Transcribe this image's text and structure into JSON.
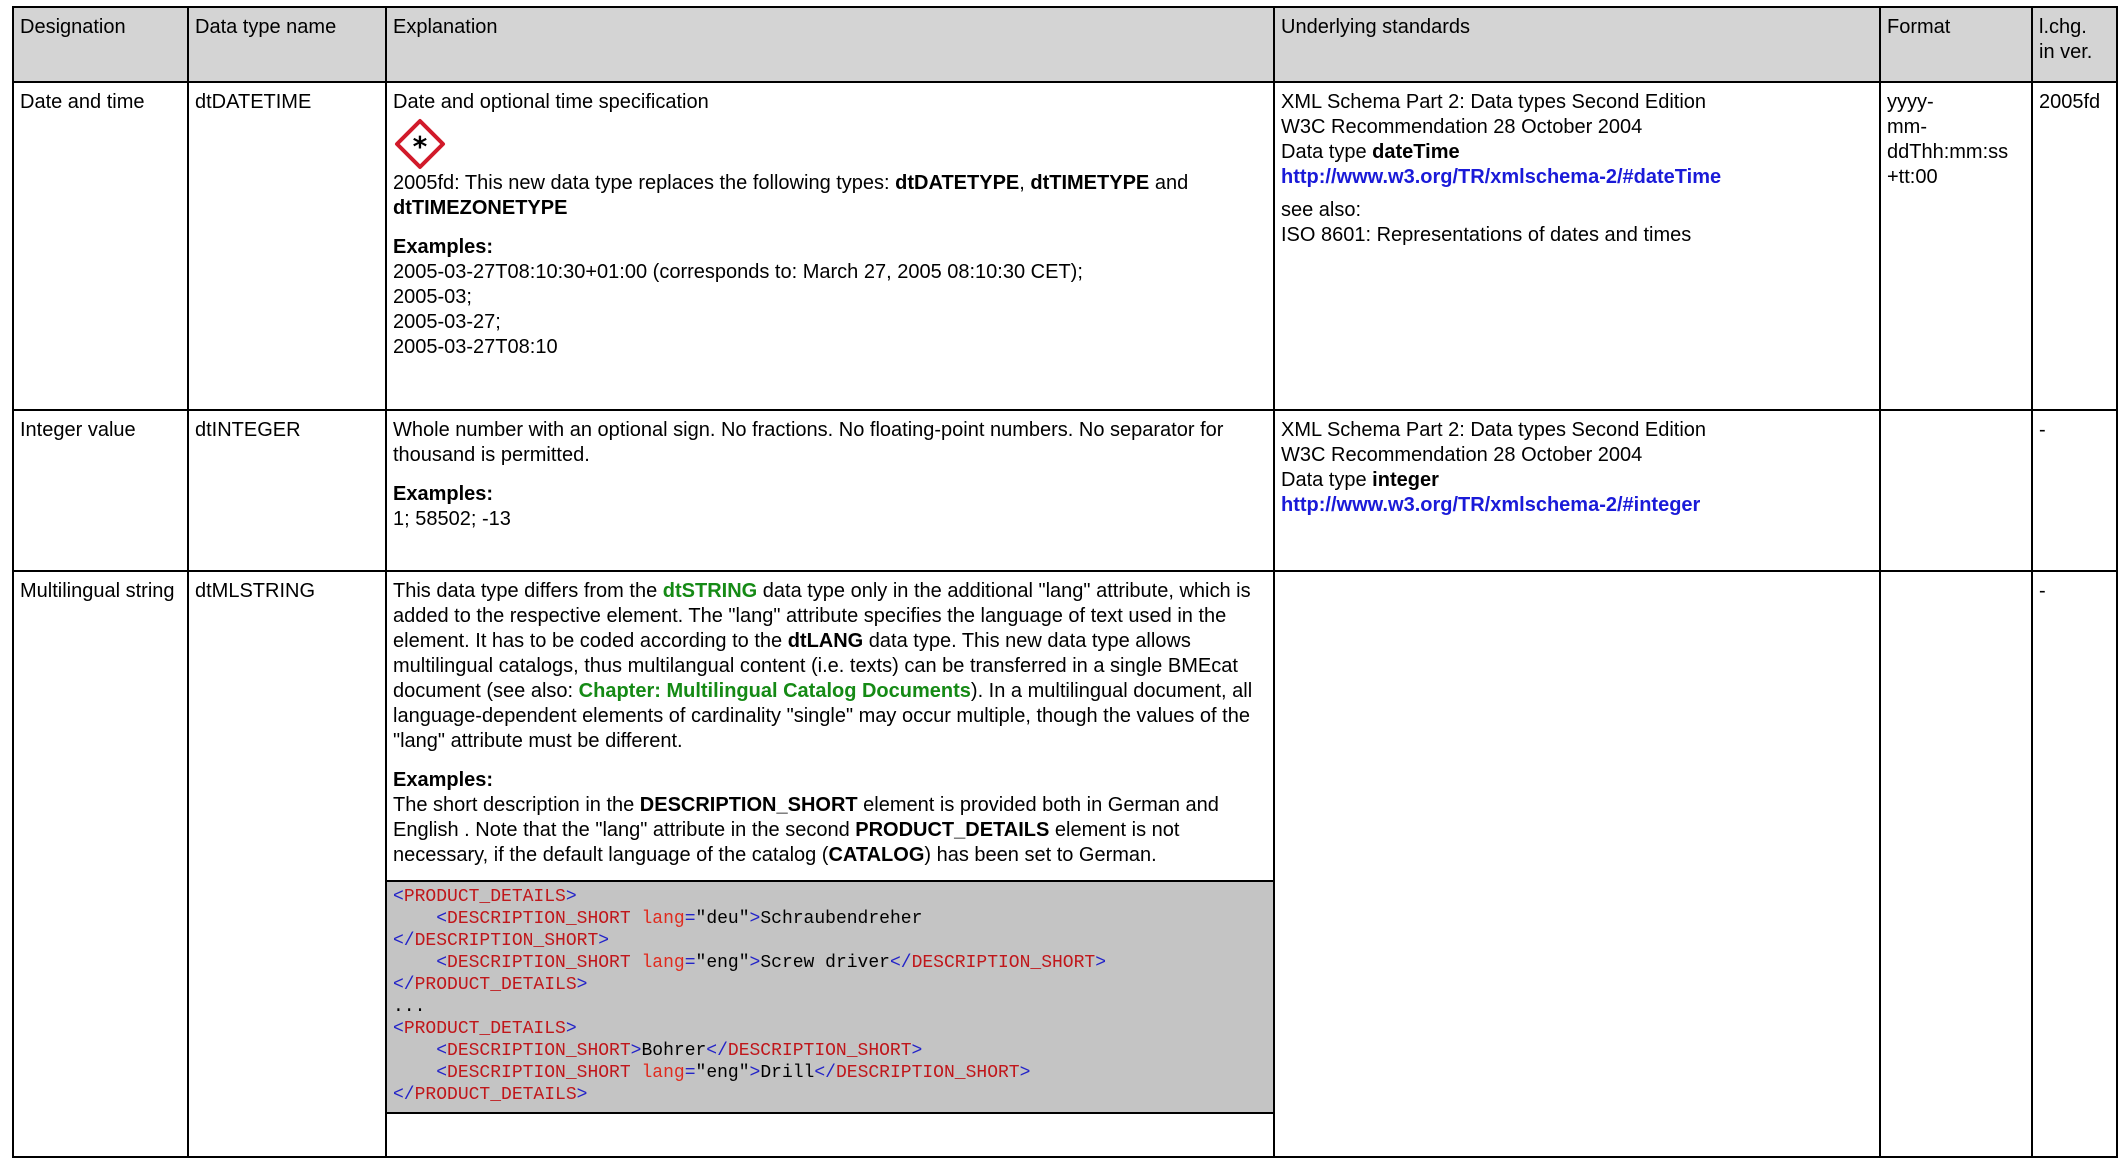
{
  "columns": {
    "designation": "Designation",
    "data_type_name": "Data type name",
    "explanation": "Explanation",
    "underlying_standards": "Underlying standards",
    "format": "Format",
    "lchg_line1": "l.chg.",
    "lchg_line2": "in ver."
  },
  "rows": [
    {
      "designation": "Date and time",
      "type_name": "dtDATETIME",
      "explanation": {
        "intro": "Date and optional time specification",
        "note_prefix": "2005fd: This new data type replaces the following types: ",
        "type1": "dtDATETYPE",
        "sep1": ", ",
        "type2": "dtTIMETYPE",
        "sep2": " and",
        "type3": "dtTIMEZONETYPE",
        "examples_label": "Examples:",
        "ex1": "2005-03-27T08:10:30+01:00 (corresponds to: March 27, 2005 08:10:30 CET);",
        "ex2": "2005-03;",
        "ex3": "2005-03-27;",
        "ex4": "2005-03-27T08:10"
      },
      "standards": {
        "line1": "XML Schema Part 2: Data types Second Edition",
        "line2": "W3C Recommendation 28 October 2004",
        "type_prefix": "Data type ",
        "type_name": "dateTime",
        "url": "http://www.w3.org/TR/xmlschema-2/#dateTime",
        "see_also": "see also:",
        "iso": "ISO 8601: Representations of dates and times"
      },
      "format": {
        "l1": "yyyy-",
        "l2": "mm-",
        "l3": "ddThh:mm:ss",
        "l4": "+tt:00"
      },
      "last_change": "2005fd"
    },
    {
      "designation": "Integer value",
      "type_name": "dtINTEGER",
      "explanation": {
        "text": "Whole number with an optional sign. No fractions. No floating-point numbers. No separator for thousand is permitted.",
        "examples_label": "Examples:",
        "examples": "1; 58502; -13"
      },
      "standards": {
        "line1": "XML Schema Part 2: Data types Second Edition",
        "line2": "W3C Recommendation 28 October 2004",
        "type_prefix": "Data type ",
        "type_name": "integer",
        "url": "http://www.w3.org/TR/xmlschema-2/#integer"
      },
      "format": "",
      "last_change": "-"
    },
    {
      "designation": "Multilingual string",
      "type_name": "dtMLSTRING",
      "explanation": {
        "t1": "This data type differs from the ",
        "link1": "dtSTRING",
        "t2": " data type only in the additional \"lang\" attribute, which is added to the respective element. The \"lang\" attribute specifies the language of text used in the element. It has to be coded according to the ",
        "b1": "dtLANG",
        "t3": " data type. This new data type allows multilingual catalogs, thus multilangual content (i.e. texts) can be transferred in a single BMEcat document (see also: ",
        "link2": "Chapter: Multilingual Catalog Documents",
        "t4": "). In a multilingual document, all language-dependent elements of cardinality \"single\" may occur multiple, though the values of the \"lang\" attribute must be different.",
        "examples_label": "Examples:",
        "e1": "The short description in the ",
        "eb1": "DESCRIPTION_SHORT",
        "e2": " element is provided both in German and English . Note that the \"lang\" attribute in the second ",
        "eb2": "PRODUCT_DETAILS",
        "e3": " element is not necessary, if the default language of the catalog (",
        "eb3": "CATALOG",
        "e4": ") has been set to German."
      },
      "code": {
        "lt": "<",
        "gt": ">",
        "lts": "</",
        "eq": "=",
        "indent": "    ",
        "tag_pd": "PRODUCT_DETAILS",
        "tag_ds": "DESCRIPTION_SHORT",
        "attr_lang": "lang",
        "val_deu": "\"deu\"",
        "val_eng": "\"eng\"",
        "txt_schraub": "Schraubendreher",
        "txt_screw": "Screw driver",
        "ellipsis": "...",
        "txt_bohrer": "Bohrer",
        "txt_drill": "Drill"
      },
      "standards": "",
      "format": "",
      "last_change": "-"
    }
  ]
}
